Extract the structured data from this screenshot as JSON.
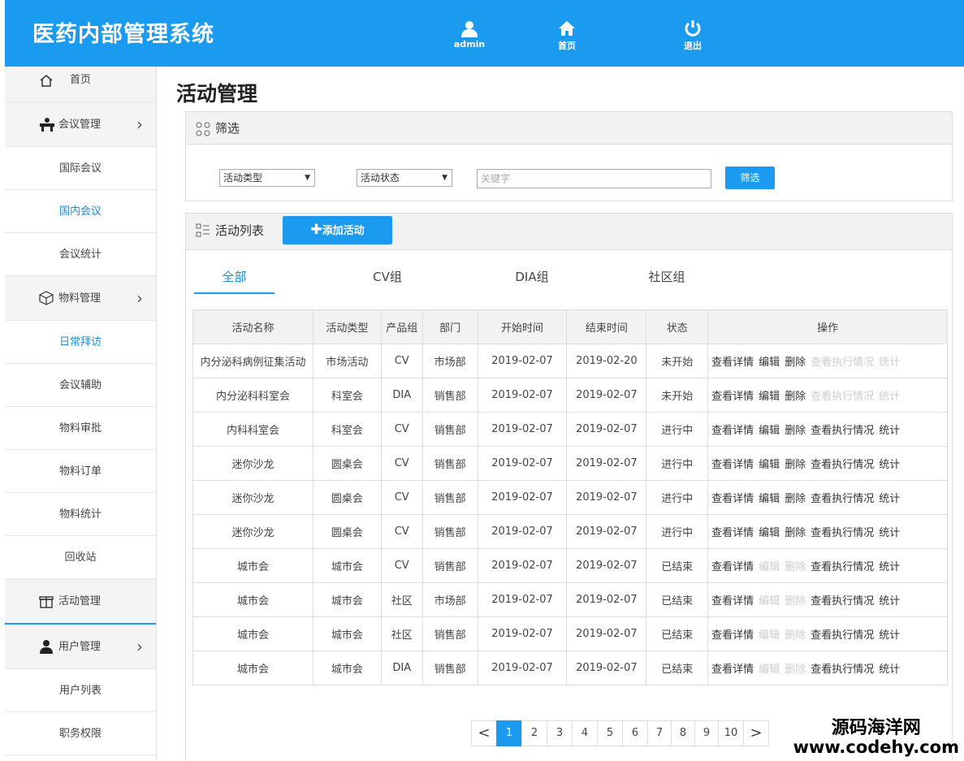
{
  "header": {
    "app_title": "医药内部管理系统",
    "nav": [
      {
        "label": "admin",
        "icon": "user-icon"
      },
      {
        "label": "首页",
        "icon": "home-icon"
      },
      {
        "label": "退出",
        "icon": "power-icon"
      }
    ]
  },
  "sidebar": {
    "home": "首页",
    "meeting": {
      "label": "会议管理",
      "items": [
        "国际会议",
        "国内会议",
        "会议统计"
      ]
    },
    "material": {
      "label": "物料管理",
      "items": [
        "日常拜访",
        "会议辅助",
        "物料审批",
        "物料订单",
        "物料统计",
        "回收站"
      ]
    },
    "activity": "活动管理",
    "user": {
      "label": "用户管理",
      "items": [
        "用户列表",
        "职务权限"
      ]
    }
  },
  "page_title": "活动管理",
  "filter": {
    "title": "筛选",
    "type_select": "活动类型",
    "status_select": "活动状态",
    "keyword_placeholder": "关键字",
    "button": "筛选"
  },
  "list": {
    "title": "活动列表",
    "add_button": "添加活动",
    "tabs": [
      "全部",
      "CV组",
      "DIA组",
      "社区组"
    ],
    "columns": [
      "活动名称",
      "活动类型",
      "产品组",
      "部门",
      "开始时间",
      "结束时间",
      "状态",
      "操作"
    ],
    "op_labels": [
      "查看详情",
      "编辑",
      "删除",
      "查看执行情况",
      "统计"
    ],
    "rows": [
      [
        "内分泌科病例征集活动",
        "市场活动",
        "CV",
        "市场部",
        "2019-02-07",
        "2019-02-20",
        "未开始"
      ],
      [
        "内分泌科科室会",
        "科室会",
        "DIA",
        "销售部",
        "2019-02-07",
        "2019-02-07",
        "未开始"
      ],
      [
        "内科科室会",
        "科室会",
        "CV",
        "销售部",
        "2019-02-07",
        "2019-02-07",
        "进行中"
      ],
      [
        "迷你沙龙",
        "圆桌会",
        "CV",
        "销售部",
        "2019-02-07",
        "2019-02-07",
        "进行中"
      ],
      [
        "迷你沙龙",
        "圆桌会",
        "CV",
        "销售部",
        "2019-02-07",
        "2019-02-07",
        "进行中"
      ],
      [
        "迷你沙龙",
        "圆桌会",
        "CV",
        "销售部",
        "2019-02-07",
        "2019-02-07",
        "进行中"
      ],
      [
        "城市会",
        "城市会",
        "CV",
        "销售部",
        "2019-02-07",
        "2019-02-07",
        "已结束"
      ],
      [
        "城市会",
        "城市会",
        "社区",
        "市场部",
        "2019-02-07",
        "2019-02-07",
        "已结束"
      ],
      [
        "城市会",
        "城市会",
        "社区",
        "销售部",
        "2019-02-07",
        "2019-02-07",
        "已结束"
      ],
      [
        "城市会",
        "城市会",
        "DIA",
        "销售部",
        "2019-02-07",
        "2019-02-07",
        "已结束"
      ]
    ]
  },
  "pagination": {
    "pages": [
      "1",
      "2",
      "3",
      "4",
      "5",
      "6",
      "7",
      "8",
      "9",
      "10"
    ],
    "current": "1",
    "prev": "<",
    "next": ">"
  },
  "watermark": {
    "line1": "源码海洋网",
    "line2": "www.codehy.com"
  },
  "colors": {
    "primary": "#1b9bf0",
    "disabled": "#cccccc"
  }
}
